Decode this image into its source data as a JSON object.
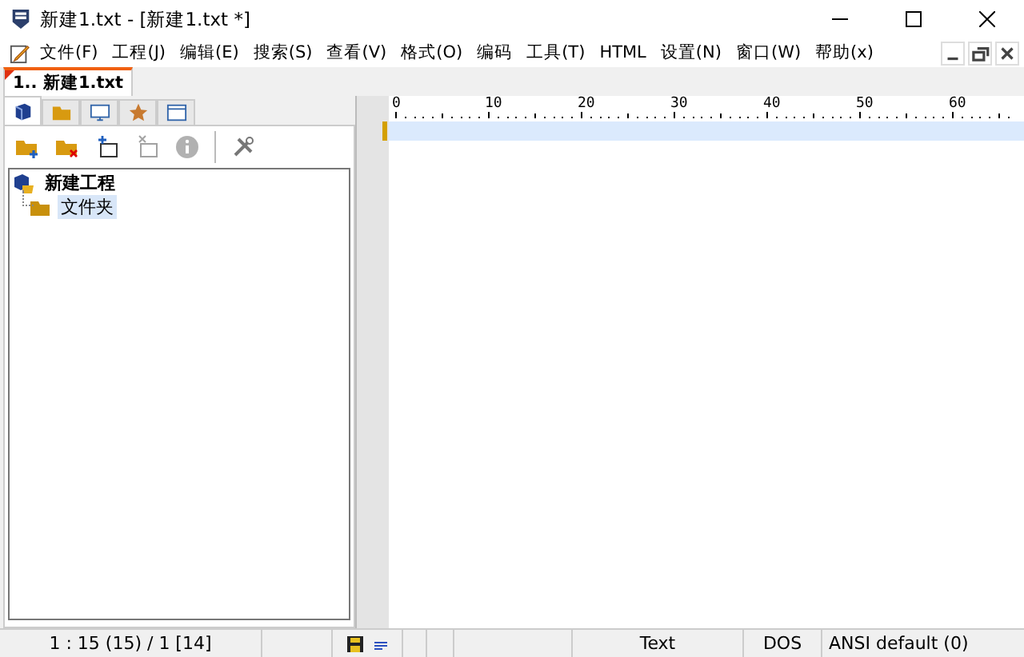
{
  "window": {
    "title": "新建1.txt - [新建1.txt *]"
  },
  "menu": [
    "文件(F)",
    "工程(J)",
    "编辑(E)",
    "搜索(S)",
    "查看(V)",
    "格式(O)",
    "编码",
    "工具(T)",
    "HTML",
    "设置(N)",
    "窗口(W)",
    "帮助(x)"
  ],
  "doc_tabs": [
    {
      "label": "1.. 新建1.txt",
      "selected": true,
      "modified": true
    }
  ],
  "panel_tabs": [
    {
      "kind": "project",
      "selected": true
    },
    {
      "kind": "folder",
      "selected": false
    },
    {
      "kind": "ftp",
      "selected": false
    },
    {
      "kind": "favorite",
      "selected": false
    },
    {
      "kind": "window",
      "selected": false
    }
  ],
  "panel_toolbar": [
    {
      "kind": "add-folder",
      "disabled": false
    },
    {
      "kind": "remove-folder",
      "disabled": false
    },
    {
      "kind": "add-file",
      "disabled": false
    },
    {
      "kind": "remove-file",
      "disabled": true
    },
    {
      "kind": "info",
      "disabled": true
    },
    {
      "kind": "sep"
    },
    {
      "kind": "tools",
      "disabled": false
    }
  ],
  "tree": [
    {
      "label": "新建工程",
      "selected": false,
      "children": [
        {
          "label": "文件夹",
          "selected": true
        }
      ]
    }
  ],
  "ruler": [
    "0",
    "10",
    "20",
    "30",
    "40",
    "50",
    "60"
  ],
  "status_bar": {
    "position": "1 : 15 (15) / 1  [14]",
    "file_type": "Text",
    "line_ending": "DOS",
    "encoding": "ANSI default (0)"
  }
}
